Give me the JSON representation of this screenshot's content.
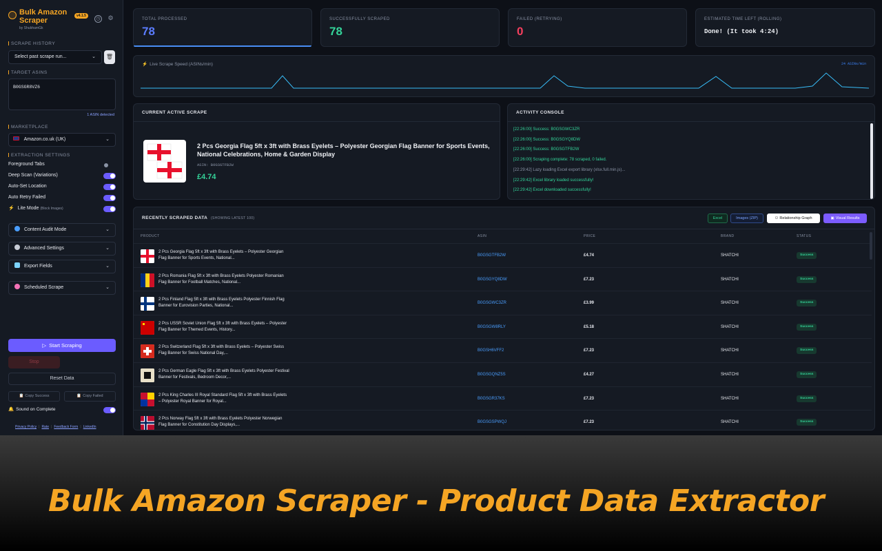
{
  "sidebar": {
    "brand_title": "Bulk Amazon Scraper",
    "brand_by": "by ShubhamGk",
    "version": "v4.1.5",
    "history_label": "SCRAPE HISTORY",
    "history_placeholder": "Select past scrape run...",
    "asins_label": "TARGET ASINS",
    "asins_value": "B0GSGR8VZ6",
    "asins_detected": "1 ASIN detected",
    "marketplace_label": "MARKETPLACE",
    "marketplace_value": "Amazon.co.uk (UK)",
    "extraction_label": "EXTRACTION SETTINGS",
    "toggles": [
      {
        "label": "Foreground Tabs",
        "on": false
      },
      {
        "label": "Deep Scan (Variations)",
        "on": true
      },
      {
        "label": "Auto-Set Location",
        "on": true
      },
      {
        "label": "Auto Retry Failed",
        "on": true
      },
      {
        "label": "Lite Mode",
        "note": "(Block Images)",
        "on": true
      }
    ],
    "accordions": [
      "Content Audit Mode",
      "Advanced Settings",
      "Export Fields",
      "Scheduled Scrape"
    ],
    "start_label": "Start Scraping",
    "stop_label": "Stop",
    "reset_label": "Reset Data",
    "copy_success": "Copy Success",
    "copy_failed": "Copy Failed",
    "sound_label": "Sound on Complete",
    "footer": [
      "Privacy Policy",
      "Rate",
      "Feedback Form",
      "LinkedIn"
    ]
  },
  "stats": [
    {
      "label": "TOTAL PROCESSED",
      "value": "78",
      "color": "#5b7cff"
    },
    {
      "label": "SUCCESSFULLY SCRAPED",
      "value": "78",
      "color": "#34d399"
    },
    {
      "label": "FAILED (RETRYING)",
      "value": "0",
      "color": "#f43f5e"
    },
    {
      "label": "ESTIMATED TIME LEFT (ROLLING)",
      "value": "Done! (It took 4:24)",
      "color": "#f0f2f6"
    }
  ],
  "speed": {
    "title": "Live Scrape Speed (ASINs/min)",
    "rate": "24 ASINs/min"
  },
  "active": {
    "header": "CURRENT ACTIVE SCRAPE",
    "title": "2 Pcs Georgia Flag 5ft x 3ft with Brass Eyelets – Polyester Georgian Flag Banner for Sports Events, National Celebrations, Home & Garden Display",
    "asin": "ASIN: B0GSGTFB2W",
    "price": "£4.74"
  },
  "console": {
    "header": "ACTIVITY CONSOLE",
    "lines": [
      {
        "text": "[22:26:00] Success: B0GSGWC3ZR",
        "kind": "ok"
      },
      {
        "text": "[22:26:00] Success: B0GSGYQ8DW",
        "kind": "ok"
      },
      {
        "text": "[22:26:00] Success: B0GSGTFB2W",
        "kind": "ok"
      },
      {
        "text": "[22:26:00] Scraping complete: 78 scraped, 0 failed.",
        "kind": "ok"
      },
      {
        "text": "[22:29:42] Lazy loading Excel export library (xlsx.full.min.js)...",
        "kind": "info"
      },
      {
        "text": "[22:29:42] Excel library loaded successfully!",
        "kind": "ok"
      },
      {
        "text": "[22:29:42] Excel downloaded successfully!",
        "kind": "ok"
      }
    ]
  },
  "table": {
    "title": "RECENTLY SCRAPED DATA",
    "subtitle": "(SHOWING LATEST 100)",
    "buttons": [
      "Excel",
      "Images (ZIP)",
      "Relationship Graph",
      "Visual Results"
    ],
    "columns": [
      "PRODUCT",
      "ASIN",
      "PRICE",
      "BRAND",
      "STATUS"
    ],
    "rows": [
      {
        "product": "2 Pcs Georgia Flag 5ft x 3ft with Brass Eyelets – Polyester Georgian Flag Banner for Sports Events, National...",
        "asin": "B0GSGTFB2W",
        "price": "£4.74",
        "brand": "SHATCHI",
        "status": "Success",
        "flag": "georgia"
      },
      {
        "product": "2 Pcs Romania Flag 5ft x 3ft with Brass Eyelets Polyester Romanian Flag Banner for Football Matches, National...",
        "asin": "B0GSGYQ8DW",
        "price": "£7.23",
        "brand": "SHATCHI",
        "status": "Success",
        "flag": "romania"
      },
      {
        "product": "2 Pcs Finland Flag 5ft x 3ft with Brass Eyelets Polyester Finnish Flag Banner for Eurovision Parties, National...",
        "asin": "B0GSGWC3ZR",
        "price": "£3.99",
        "brand": "SHATCHI",
        "status": "Success",
        "flag": "finland"
      },
      {
        "product": "2 Pcs USSR Soviet Union Flag 5ft x 3ft with Brass Eyelets – Polyester Flag Banner for Themed Events, History...",
        "asin": "B0GSGW8RLY",
        "price": "£5.18",
        "brand": "SHATCHI",
        "status": "Success",
        "flag": "ussr"
      },
      {
        "product": "2 Pcs Switzerland Flag 5ft x 3ft with Brass Eyelets – Polyester Swiss Flag Banner for Swiss National Day,...",
        "asin": "B0GSH6VFF2",
        "price": "£7.23",
        "brand": "SHATCHI",
        "status": "Success",
        "flag": "swiss"
      },
      {
        "product": "2 Pcs German Eagle Flag 5ft x 3ft with Brass Eyelets Polyester Festival Banner for Festivals, Bedroom Decor,...",
        "asin": "B0GSGQNZ5S",
        "price": "£4.27",
        "brand": "SHATCHI",
        "status": "Success",
        "flag": "german"
      },
      {
        "product": "2 Pcs King Charles III Royal Standard Flag 5ft x 3ft with Brass Eyelets – Polyester Royal Banner for Royal...",
        "asin": "B0GSGR37KS",
        "price": "£7.23",
        "brand": "SHATCHI",
        "status": "Success",
        "flag": "royal"
      },
      {
        "product": "2 Pcs Norway Flag 5ft x 3ft with Brass Eyelets Polyester Norwegian Flag Banner for Constitution Day Displays,...",
        "asin": "B0GSGSPWQJ",
        "price": "£7.23",
        "brand": "SHATCHI",
        "status": "Success",
        "flag": "norway"
      }
    ]
  },
  "banner": "Bulk Amazon Scraper - Product Data Extractor",
  "colors": {
    "accent": "#6b5cff",
    "brand": "#f5a524",
    "success": "#34d399",
    "link": "#4a9eff"
  }
}
